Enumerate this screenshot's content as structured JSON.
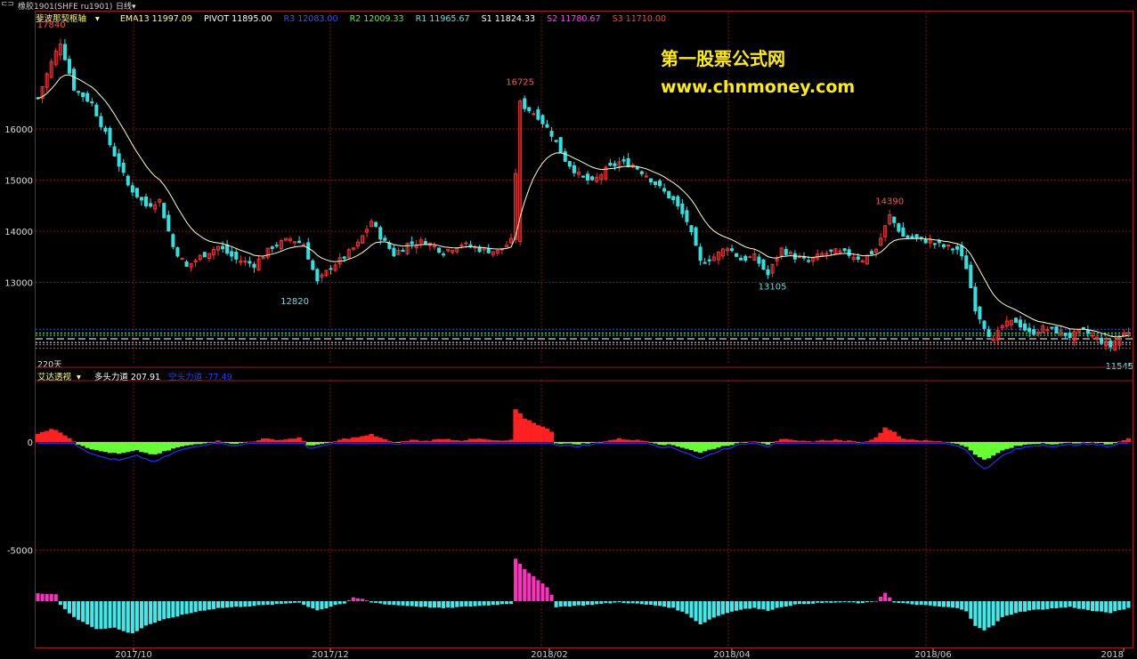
{
  "window": {
    "symbol": "橡胶1901(SHFE ru1901)",
    "period": "日线",
    "period_arrow": "▾"
  },
  "main_legend": {
    "indicator": "斐波那契枢轴",
    "ema": "EMA13 11997.09",
    "pivot": "PIVOT 11895.00",
    "r3": "R3 12083.00",
    "r2": "R2 12009.33",
    "r1": "R1 11965.67",
    "s1": "S1 11824.33",
    "s2": "S2 11780.67",
    "s3": "S3 11710.00"
  },
  "colors": {
    "background": "#000000",
    "up": "#ff3030",
    "down": "#33e0e0",
    "ema": "#ffffcc",
    "grid": "#7a1010",
    "axis": "#a01818",
    "r3": "#3050ff",
    "r2": "#40ff40",
    "r1": "#60e0e0",
    "s1": "#ffffff",
    "s2": "#ff40ff",
    "s3": "#ff4040",
    "bull_bar": "#ff2020",
    "bear_bar": "#66ff33",
    "bear_line": "#2030ff",
    "magenta_bar": "#ff30c0",
    "cyan_bar": "#44e8e8",
    "watermark": "#ffee00"
  },
  "watermark": {
    "line1": "第一股票公式网",
    "line2": "www.chnmoney.com"
  },
  "bars_label": "220天",
  "indicator_legend": {
    "name": "艾达透视",
    "bull": "多头力道 207.91",
    "bear": "空头力道 -77.49"
  },
  "x_labels": [
    "2017/10",
    "2017/12",
    "2018/02",
    "2018/04",
    "2018/06",
    "2018"
  ],
  "chart_data": {
    "type": "candlestick",
    "price_axis": {
      "ticks": [
        13000,
        14000,
        15000,
        16000
      ],
      "ylim": [
        11300,
        18250
      ]
    },
    "indicator_axis": {
      "ticks": [
        0,
        -5000
      ]
    },
    "annotations": [
      {
        "label": "17840",
        "value": 17840,
        "kind": "high"
      },
      {
        "label": "12820",
        "value": 12820,
        "kind": "low"
      },
      {
        "label": "16725",
        "value": 16725,
        "kind": "high"
      },
      {
        "label": "13105",
        "value": 13105,
        "kind": "low"
      },
      {
        "label": "14390",
        "value": 14390,
        "kind": "high"
      },
      {
        "label": "11545",
        "value": 11545,
        "kind": "low"
      }
    ],
    "pivot_levels": [
      {
        "name": "R3",
        "value": 12083.0
      },
      {
        "name": "R2",
        "value": 12009.33
      },
      {
        "name": "R1",
        "value": 11965.67
      },
      {
        "name": "PIVOT",
        "value": 11895.0
      },
      {
        "name": "S1",
        "value": 11824.33
      },
      {
        "name": "S2",
        "value": 11780.67
      },
      {
        "name": "S3",
        "value": 11710.0
      }
    ],
    "close_anchors": [
      [
        0,
        16600
      ],
      [
        3,
        17300
      ],
      [
        5,
        17700
      ],
      [
        8,
        16800
      ],
      [
        12,
        16500
      ],
      [
        16,
        15700
      ],
      [
        20,
        14900
      ],
      [
        24,
        14500
      ],
      [
        27,
        14600
      ],
      [
        30,
        13700
      ],
      [
        33,
        13300
      ],
      [
        36,
        13500
      ],
      [
        40,
        13700
      ],
      [
        44,
        13450
      ],
      [
        48,
        13350
      ],
      [
        52,
        13700
      ],
      [
        56,
        13850
      ],
      [
        59,
        13750
      ],
      [
        62,
        13000
      ],
      [
        65,
        13300
      ],
      [
        68,
        13500
      ],
      [
        71,
        13750
      ],
      [
        74,
        14200
      ],
      [
        76,
        13900
      ],
      [
        79,
        13550
      ],
      [
        82,
        13750
      ],
      [
        86,
        13800
      ],
      [
        90,
        13600
      ],
      [
        94,
        13750
      ],
      [
        98,
        13650
      ],
      [
        102,
        13600
      ],
      [
        105,
        13800
      ],
      [
        107,
        16500
      ],
      [
        111,
        16250
      ],
      [
        114,
        15900
      ],
      [
        117,
        15400
      ],
      [
        120,
        15100
      ],
      [
        123,
        14950
      ],
      [
        126,
        15200
      ],
      [
        129,
        15350
      ],
      [
        132,
        15300
      ],
      [
        135,
        15100
      ],
      [
        138,
        14850
      ],
      [
        141,
        14600
      ],
      [
        144,
        14200
      ],
      [
        147,
        13400
      ],
      [
        150,
        13500
      ],
      [
        153,
        13700
      ],
      [
        156,
        13450
      ],
      [
        159,
        13500
      ],
      [
        162,
        13150
      ],
      [
        165,
        13650
      ],
      [
        168,
        13500
      ],
      [
        171,
        13400
      ],
      [
        174,
        13550
      ],
      [
        177,
        13600
      ],
      [
        180,
        13550
      ],
      [
        183,
        13450
      ],
      [
        186,
        13650
      ],
      [
        189,
        14300
      ],
      [
        192,
        13900
      ],
      [
        195,
        13850
      ],
      [
        198,
        13800
      ],
      [
        201,
        13700
      ],
      [
        204,
        13650
      ],
      [
        206,
        13300
      ],
      [
        208,
        12500
      ],
      [
        210,
        12150
      ],
      [
        212,
        11850
      ],
      [
        214,
        12150
      ],
      [
        217,
        12250
      ],
      [
        220,
        12000
      ],
      [
        223,
        12100
      ],
      [
        226,
        12050
      ],
      [
        229,
        11950
      ],
      [
        232,
        12050
      ],
      [
        235,
        11900
      ],
      [
        238,
        11750
      ],
      [
        240,
        11950
      ],
      [
        242,
        12050
      ]
    ],
    "bull_anchors": [
      [
        0,
        400
      ],
      [
        3,
        600
      ],
      [
        5,
        450
      ],
      [
        7,
        200
      ],
      [
        9,
        -100
      ],
      [
        13,
        -400
      ],
      [
        18,
        -550
      ],
      [
        22,
        -400
      ],
      [
        26,
        -600
      ],
      [
        28,
        -450
      ],
      [
        31,
        -250
      ],
      [
        35,
        -100
      ],
      [
        40,
        50
      ],
      [
        44,
        -100
      ],
      [
        48,
        50
      ],
      [
        50,
        150
      ],
      [
        54,
        100
      ],
      [
        58,
        200
      ],
      [
        60,
        -150
      ],
      [
        64,
        -80
      ],
      [
        68,
        150
      ],
      [
        72,
        250
      ],
      [
        74,
        350
      ],
      [
        76,
        200
      ],
      [
        79,
        -50
      ],
      [
        83,
        100
      ],
      [
        86,
        50
      ],
      [
        90,
        150
      ],
      [
        94,
        80
      ],
      [
        98,
        150
      ],
      [
        102,
        50
      ],
      [
        105,
        80
      ],
      [
        106,
        1500
      ],
      [
        108,
        1100
      ],
      [
        111,
        800
      ],
      [
        114,
        500
      ],
      [
        115,
        -50
      ],
      [
        119,
        -100
      ],
      [
        123,
        -50
      ],
      [
        126,
        50
      ],
      [
        129,
        150
      ],
      [
        132,
        100
      ],
      [
        135,
        50
      ],
      [
        138,
        -100
      ],
      [
        141,
        -150
      ],
      [
        144,
        -300
      ],
      [
        147,
        -500
      ],
      [
        150,
        -300
      ],
      [
        153,
        -150
      ],
      [
        156,
        -50
      ],
      [
        159,
        50
      ],
      [
        162,
        -100
      ],
      [
        165,
        150
      ],
      [
        168,
        50
      ],
      [
        171,
        30
      ],
      [
        174,
        80
      ],
      [
        177,
        100
      ],
      [
        180,
        50
      ],
      [
        183,
        -20
      ],
      [
        186,
        200
      ],
      [
        188,
        700
      ],
      [
        190,
        450
      ],
      [
        192,
        150
      ],
      [
        195,
        100
      ],
      [
        198,
        50
      ],
      [
        201,
        20
      ],
      [
        204,
        -80
      ],
      [
        206,
        -200
      ],
      [
        208,
        -600
      ],
      [
        210,
        -800
      ],
      [
        212,
        -650
      ],
      [
        214,
        -400
      ],
      [
        217,
        -200
      ],
      [
        220,
        -100
      ],
      [
        223,
        -50
      ],
      [
        226,
        -100
      ],
      [
        229,
        -50
      ],
      [
        232,
        -30
      ],
      [
        235,
        -50
      ],
      [
        238,
        -100
      ],
      [
        240,
        20
      ],
      [
        242,
        150
      ]
    ],
    "lower_anchors": [
      [
        0,
        350
      ],
      [
        3,
        320
      ],
      [
        4,
        300
      ],
      [
        5,
        -150
      ],
      [
        8,
        -700
      ],
      [
        13,
        -1200
      ],
      [
        17,
        -1150
      ],
      [
        19,
        -1300
      ],
      [
        21,
        -1400
      ],
      [
        24,
        -1050
      ],
      [
        28,
        -800
      ],
      [
        32,
        -600
      ],
      [
        36,
        -420
      ],
      [
        40,
        -300
      ],
      [
        44,
        -250
      ],
      [
        48,
        -200
      ],
      [
        52,
        -150
      ],
      [
        55,
        -100
      ],
      [
        58,
        -50
      ],
      [
        60,
        -250
      ],
      [
        62,
        -380
      ],
      [
        64,
        -300
      ],
      [
        66,
        -160
      ],
      [
        68,
        -100
      ],
      [
        70,
        150
      ],
      [
        72,
        100
      ],
      [
        74,
        -50
      ],
      [
        78,
        -150
      ],
      [
        82,
        -200
      ],
      [
        86,
        -250
      ],
      [
        90,
        -300
      ],
      [
        94,
        -250
      ],
      [
        98,
        -200
      ],
      [
        102,
        -150
      ],
      [
        105,
        -100
      ],
      [
        106,
        1850
      ],
      [
        108,
        1400
      ],
      [
        111,
        900
      ],
      [
        113,
        600
      ],
      [
        114,
        300
      ],
      [
        115,
        -250
      ],
      [
        119,
        -200
      ],
      [
        123,
        -150
      ],
      [
        126,
        -100
      ],
      [
        129,
        -50
      ],
      [
        132,
        -100
      ],
      [
        135,
        -150
      ],
      [
        138,
        -200
      ],
      [
        141,
        -300
      ],
      [
        144,
        -550
      ],
      [
        147,
        -1000
      ],
      [
        150,
        -700
      ],
      [
        153,
        -500
      ],
      [
        156,
        -350
      ],
      [
        159,
        -300
      ],
      [
        162,
        -400
      ],
      [
        165,
        -250
      ],
      [
        168,
        -150
      ],
      [
        171,
        -100
      ],
      [
        174,
        -80
      ],
      [
        177,
        -60
      ],
      [
        180,
        -50
      ],
      [
        183,
        -100
      ],
      [
        186,
        20
      ],
      [
        188,
        380
      ],
      [
        190,
        -60
      ],
      [
        192,
        -100
      ],
      [
        195,
        -150
      ],
      [
        198,
        -200
      ],
      [
        201,
        -250
      ],
      [
        204,
        -300
      ],
      [
        206,
        -450
      ],
      [
        208,
        -1050
      ],
      [
        210,
        -1250
      ],
      [
        212,
        -1050
      ],
      [
        214,
        -700
      ],
      [
        217,
        -500
      ],
      [
        220,
        -400
      ],
      [
        223,
        -350
      ],
      [
        226,
        -300
      ],
      [
        229,
        -250
      ],
      [
        232,
        -350
      ],
      [
        235,
        -450
      ],
      [
        238,
        -500
      ],
      [
        240,
        -400
      ],
      [
        242,
        -300
      ]
    ]
  }
}
